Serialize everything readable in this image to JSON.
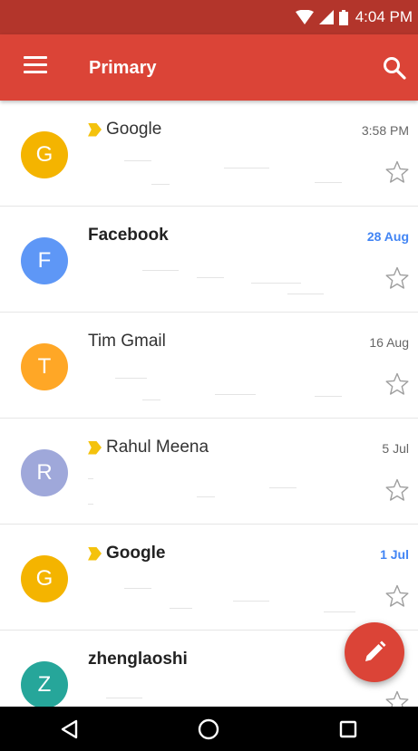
{
  "status_bar": {
    "time": "4:04 PM"
  },
  "app_bar": {
    "title": "Primary"
  },
  "emails": [
    {
      "avatar_letter": "G",
      "avatar_color": "#F4B400",
      "sender": "Google",
      "date": "3:58 PM",
      "unread": false,
      "important": true
    },
    {
      "avatar_letter": "F",
      "avatar_color": "#5E97F6",
      "sender": "Facebook",
      "date": "28 Aug",
      "unread": true,
      "important": false
    },
    {
      "avatar_letter": "T",
      "avatar_color": "#FFA726",
      "sender": "Tim Gmail",
      "date": "16 Aug",
      "unread": false,
      "important": false
    },
    {
      "avatar_letter": "R",
      "avatar_color": "#9FA8DA",
      "sender": "Rahul Meena",
      "date": "5 Jul",
      "unread": false,
      "important": true
    },
    {
      "avatar_letter": "G",
      "avatar_color": "#F4B400",
      "sender": "Google",
      "date": "1 Jul",
      "unread": true,
      "important": true
    },
    {
      "avatar_letter": "Z",
      "avatar_color": "#26A69A",
      "sender": "zhenglaoshi",
      "date": "",
      "unread": true,
      "important": false
    }
  ],
  "icons": {
    "menu": "hamburger-menu-icon",
    "search": "search-icon",
    "star": "star-outline-icon",
    "compose": "pencil-icon",
    "back": "triangle-back-icon",
    "home": "circle-home-icon",
    "recents": "square-recents-icon"
  },
  "colors": {
    "app_bar": "#DB4437",
    "status_bar": "#B3352B",
    "unread_date": "#4285F4",
    "importance_marker": "#F4C20D"
  }
}
